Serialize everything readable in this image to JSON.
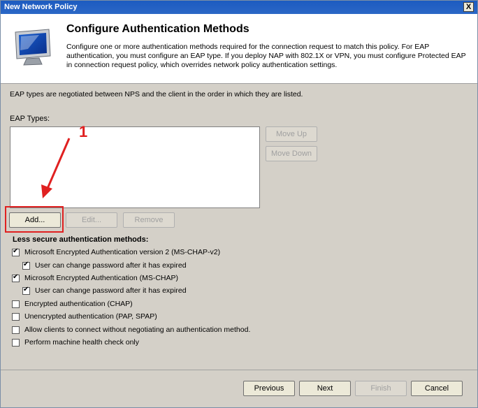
{
  "window": {
    "title": "New Network Policy",
    "close_glyph": "X"
  },
  "header": {
    "title": "Configure Authentication Methods",
    "description": "Configure one or more authentication methods required for the connection request to match this policy. For EAP authentication, you must configure an EAP type. If you deploy NAP with 802.1X or VPN, you must configure Protected EAP in connection request policy, which overrides network policy authentication settings.",
    "icon": "computer-monitor-icon"
  },
  "info_text": "EAP types are negotiated between NPS and the client in the order in which they are listed.",
  "eap": {
    "label": "EAP Types:",
    "items": [],
    "move_up": "Move Up",
    "move_down": "Move Down",
    "add": "Add...",
    "edit": "Edit...",
    "remove": "Remove"
  },
  "less_secure": {
    "label": "Less secure authentication methods:",
    "options": [
      {
        "label": "Microsoft Encrypted Authentication version 2 (MS-CHAP-v2)",
        "checked": true
      },
      {
        "label": "User can change password after it has expired",
        "checked": true
      },
      {
        "label": "Microsoft Encrypted Authentication (MS-CHAP)",
        "checked": true
      },
      {
        "label": "User can change password after it has expired",
        "checked": true
      },
      {
        "label": "Encrypted authentication (CHAP)",
        "checked": false
      },
      {
        "label": "Unencrypted authentication (PAP, SPAP)",
        "checked": false
      },
      {
        "label": "Allow clients to connect without negotiating an authentication method.",
        "checked": false
      },
      {
        "label": "Perform machine health check only",
        "checked": false
      }
    ]
  },
  "footer": {
    "previous": "Previous",
    "next": "Next",
    "finish": "Finish",
    "cancel": "Cancel"
  },
  "annotation": {
    "number": "1",
    "color": "#e02020"
  }
}
